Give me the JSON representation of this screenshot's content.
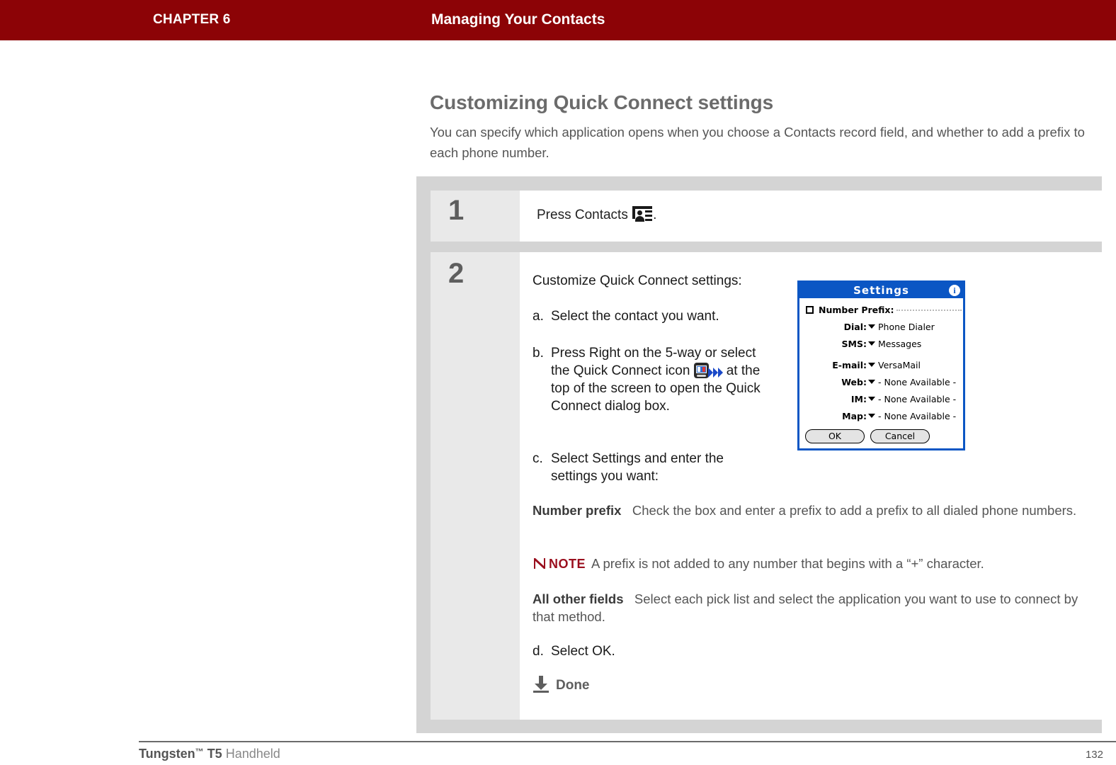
{
  "header": {
    "chapter": "CHAPTER 6",
    "title": "Managing Your Contacts",
    "background_color": "#8c0306"
  },
  "section": {
    "heading": "Customizing Quick Connect settings",
    "intro": "You can specify which application opens when you choose a Contacts record field, and whether to add a prefix to each phone number."
  },
  "steps": [
    {
      "number": "1",
      "text_before_icon": "Press Contacts ",
      "icon": "contacts-icon",
      "text_after_icon": "."
    },
    {
      "number": "2",
      "lead": "Customize Quick Connect settings:",
      "a_label": "a.",
      "a_text": "Select the contact you want.",
      "b_label": "b.",
      "b_text_1": "Press Right on the 5-way or select the Quick Connect icon",
      "b_icon": "quick-connect-icon",
      "b_text_2": "at the top of the screen to open the Quick Connect dialog box.",
      "c_label": "c.",
      "c_text": "Select Settings and enter the settings you want:",
      "d_label": "d.",
      "d_text": "Select OK."
    }
  ],
  "descriptions": [
    {
      "term": "Number prefix",
      "text": "Check the box and enter a prefix to add a prefix to all dialed phone numbers."
    },
    {
      "term": "All other fields",
      "text": "Select each pick list and select the application you want to use to connect by that method."
    }
  ],
  "note": {
    "label": "NOTE",
    "text": "A prefix is not added to any number that begins with a “+” character.",
    "color": "#9a0f1e"
  },
  "done": {
    "label": "Done",
    "icon": "download-arrow-icon"
  },
  "palm_dialog": {
    "title": "Settings",
    "info_icon": "info-icon",
    "accent_color": "#0b56c4",
    "rows": [
      {
        "label": "Number Prefix:",
        "value": "",
        "type": "checkbox-field"
      },
      {
        "label": "Dial:",
        "value": "Phone Dialer",
        "type": "picklist"
      },
      {
        "label": "SMS:",
        "value": "Messages",
        "type": "picklist"
      },
      {
        "label": "E-mail:",
        "value": "VersaMail",
        "type": "picklist"
      },
      {
        "label": "Web:",
        "value": "- None Available -",
        "type": "picklist"
      },
      {
        "label": "IM:",
        "value": "- None Available -",
        "type": "picklist"
      },
      {
        "label": "Map:",
        "value": "- None Available -",
        "type": "picklist"
      }
    ],
    "buttons": {
      "ok": "OK",
      "cancel": "Cancel"
    }
  },
  "footer": {
    "product_bold": "Tungsten",
    "tm": "™",
    "model_bold": "T5",
    "product_rest": "Handheld",
    "page_number": "132"
  }
}
